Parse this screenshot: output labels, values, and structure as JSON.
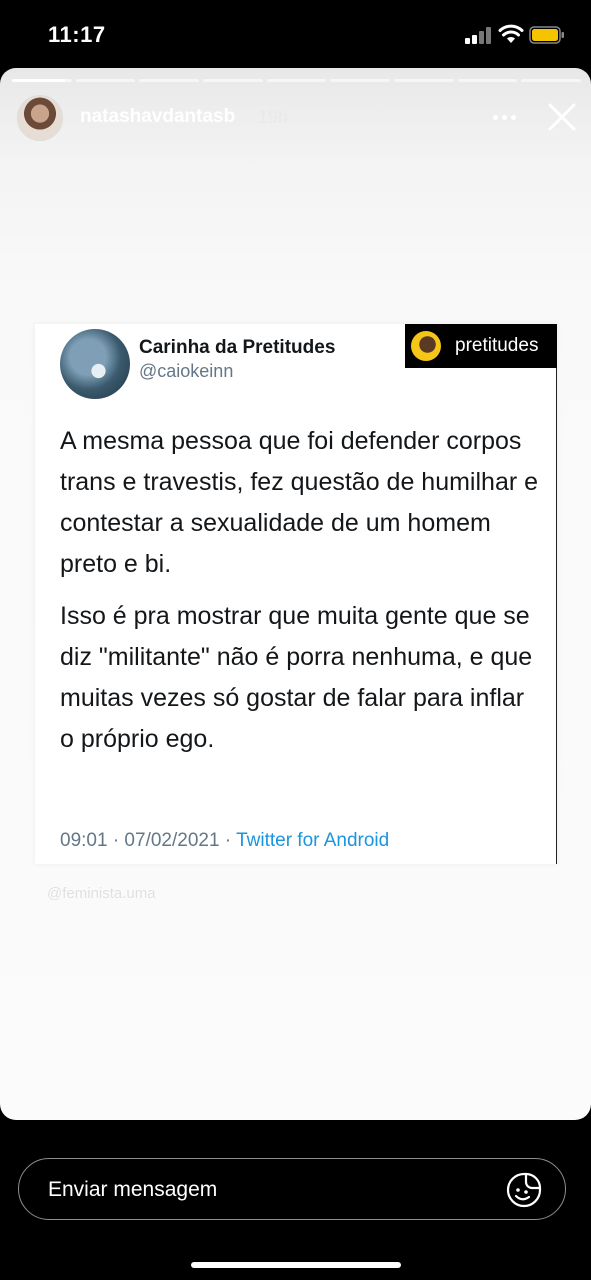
{
  "status_bar": {
    "time": "11:17",
    "signal_icon": "cellular-signal-icon",
    "wifi_icon": "wifi-icon",
    "battery_icon": "battery-icon",
    "battery_color": "#f5c400"
  },
  "story": {
    "segments_total": 9,
    "active_segment": 1,
    "user": {
      "username": "natashavdantasb",
      "time_ago": "19h"
    },
    "more_icon": "more-options-icon",
    "close_icon": "close-icon"
  },
  "tweet": {
    "author_name": "Carinha da Pretitudes",
    "author_handle": "@caiokeinn",
    "badge_text": "pretitudes",
    "paragraphs": [
      "A mesma pessoa que foi defender corpos trans e travestis, fez questão de humilhar e contestar a sexualidade de um homem preto e bi.",
      "Isso é pra mostrar que muita gente que se diz \"militante\" não é porra nenhuma, e que muitas vezes só gostar de falar para inflar o próprio ego."
    ],
    "timestamp": "09:01 · 07/02/2021 ·",
    "source": "Twitter for Android",
    "source_color": "#1b95e0"
  },
  "watermark": "@feminista.uma",
  "message_bar": {
    "placeholder": "Enviar mensagem",
    "sticker_icon": "sticker-icon"
  }
}
